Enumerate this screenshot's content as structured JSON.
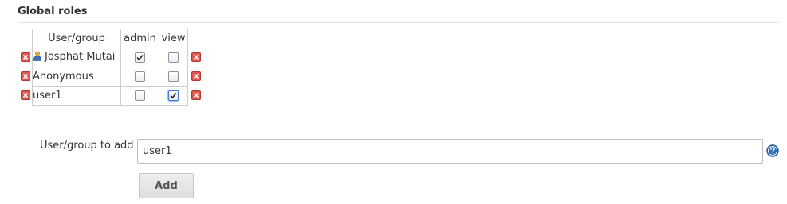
{
  "section": {
    "title": "Global roles"
  },
  "table": {
    "headers": [
      "User/group",
      "admin",
      "view"
    ],
    "rows": [
      {
        "name": "Josphat Mutai",
        "has_user_icon": true,
        "admin": true,
        "view": false
      },
      {
        "name": "Anonymous",
        "has_user_icon": false,
        "admin": false,
        "view": false
      },
      {
        "name": "user1",
        "has_user_icon": false,
        "admin": false,
        "view": true
      }
    ]
  },
  "add_form": {
    "label": "User/group to add",
    "input_value": "user1",
    "button_label": "Add"
  },
  "icons": {
    "delete": "delete-icon",
    "help": "help-icon",
    "user": "user-icon"
  },
  "colors": {
    "delete_red": "#e0574f",
    "help_blue": "#2a6fb6",
    "focus_blue": "#3f7bd8"
  }
}
